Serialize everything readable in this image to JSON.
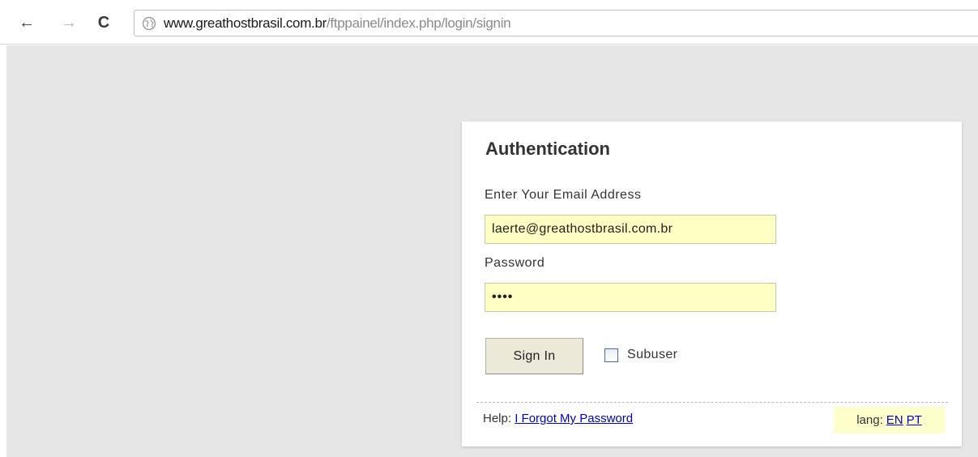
{
  "browser": {
    "back_glyph": "←",
    "forward_glyph": "→",
    "reload_glyph": "C",
    "url_host": "www.greathostbrasil.com.br",
    "url_path": "/ftppainel/index.php/login/signin"
  },
  "auth": {
    "title": "Authentication",
    "email_label": "Enter Your Email Address",
    "email_value": "laerte@greathostbrasil.com.br",
    "password_label": "Password",
    "password_value": "••••",
    "signin_label": "Sign In",
    "subuser_label": "Subuser",
    "help_label": "Help:",
    "forgot_link": "I Forgot My Password",
    "lang_label": "lang:",
    "lang_options": [
      "EN",
      "PT"
    ]
  },
  "icons": {
    "back": "back-arrow-icon",
    "forward": "forward-arrow-icon",
    "reload": "reload-icon",
    "site": "globe-icon"
  },
  "colors": {
    "page_bg": "#e6e6e6",
    "input_bg": "#ffffc4",
    "link": "#0000cc",
    "button_bg": "#ece9d8"
  }
}
